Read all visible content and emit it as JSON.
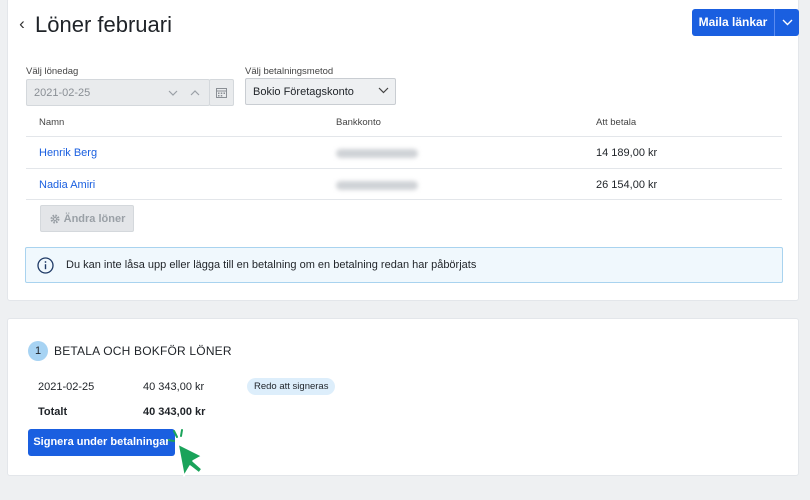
{
  "header": {
    "back_icon": "chevron-left-icon",
    "title": "Löner februari",
    "mail_button": "Maila länkar",
    "mail_dropdown_icon": "chevron-down-icon"
  },
  "form": {
    "date_label": "Välj lönedag",
    "date_value": "2021-02-25",
    "method_label": "Välj betalningsmetod",
    "method_value": "Bokio Företagskonto"
  },
  "table": {
    "columns": [
      "Namn",
      "Bankkonto",
      "Att betala"
    ],
    "rows": [
      {
        "name": "Henrik Berg",
        "amount": "14 189,00 kr"
      },
      {
        "name": "Nadia Amiri",
        "amount": "26 154,00 kr"
      }
    ]
  },
  "change_button": "Ändra löner",
  "info": {
    "icon": "info-icon",
    "text": "Du kan inte låsa upp eller lägga till en betalning om en betalning redan har påbörjats"
  },
  "step": {
    "number": "1",
    "title": "BETALA OCH BOKFÖR LÖNER",
    "date": "2021-02-25",
    "amount": "40 343,00 kr",
    "status": "Redo att signeras",
    "total_label": "Totalt",
    "total_amount": "40 343,00 kr",
    "sign_button": "Signera under betalningar"
  },
  "colors": {
    "accent": "#1a5fe0",
    "info_border": "#a9d3ef",
    "badge": "#ddeefb",
    "cursor": "#1aa35a"
  }
}
